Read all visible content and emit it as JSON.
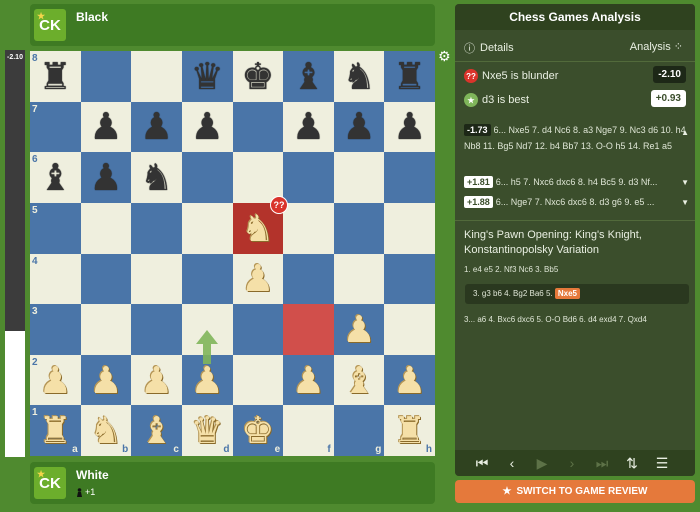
{
  "players": {
    "black": {
      "name": "Black",
      "logo": "CK"
    },
    "white": {
      "name": "White",
      "logo": "CK",
      "material": "+1"
    }
  },
  "eval_bar": {
    "label": "-2.10",
    "white_fraction": 0.31
  },
  "board": {
    "files": [
      "a",
      "b",
      "c",
      "d",
      "e",
      "f",
      "g",
      "h"
    ],
    "ranks": [
      "8",
      "7",
      "6",
      "5",
      "4",
      "3",
      "2",
      "1"
    ],
    "pieces": [
      {
        "sq": "a8",
        "p": "r",
        "c": "b"
      },
      {
        "sq": "d8",
        "p": "q",
        "c": "b"
      },
      {
        "sq": "e8",
        "p": "k",
        "c": "b"
      },
      {
        "sq": "f8",
        "p": "b",
        "c": "b"
      },
      {
        "sq": "g8",
        "p": "n",
        "c": "b"
      },
      {
        "sq": "h8",
        "p": "r",
        "c": "b"
      },
      {
        "sq": "b7",
        "p": "p",
        "c": "b"
      },
      {
        "sq": "c7",
        "p": "p",
        "c": "b"
      },
      {
        "sq": "d7",
        "p": "p",
        "c": "b"
      },
      {
        "sq": "f7",
        "p": "p",
        "c": "b"
      },
      {
        "sq": "g7",
        "p": "p",
        "c": "b"
      },
      {
        "sq": "h7",
        "p": "p",
        "c": "b"
      },
      {
        "sq": "a6",
        "p": "b",
        "c": "b"
      },
      {
        "sq": "b6",
        "p": "p",
        "c": "b"
      },
      {
        "sq": "c6",
        "p": "n",
        "c": "b"
      },
      {
        "sq": "e5",
        "p": "n",
        "c": "w"
      },
      {
        "sq": "e4",
        "p": "p",
        "c": "w"
      },
      {
        "sq": "g3",
        "p": "p",
        "c": "w"
      },
      {
        "sq": "a2",
        "p": "p",
        "c": "w"
      },
      {
        "sq": "b2",
        "p": "p",
        "c": "w"
      },
      {
        "sq": "c2",
        "p": "p",
        "c": "w"
      },
      {
        "sq": "d2",
        "p": "p",
        "c": "w"
      },
      {
        "sq": "f2",
        "p": "p",
        "c": "w"
      },
      {
        "sq": "g2",
        "p": "b",
        "c": "w"
      },
      {
        "sq": "h2",
        "p": "p",
        "c": "w"
      },
      {
        "sq": "a1",
        "p": "r",
        "c": "w"
      },
      {
        "sq": "b1",
        "p": "n",
        "c": "w"
      },
      {
        "sq": "c1",
        "p": "b",
        "c": "w"
      },
      {
        "sq": "d1",
        "p": "q",
        "c": "w"
      },
      {
        "sq": "e1",
        "p": "k",
        "c": "w"
      },
      {
        "sq": "h1",
        "p": "r",
        "c": "w"
      }
    ],
    "highlight_squares": {
      "e5": "#b3332b",
      "f3": "#d14f4b"
    },
    "blunder_badge": "??"
  },
  "panel": {
    "title": "Chess Games Analysis",
    "tab_details": "Details",
    "tab_analysis": "Analysis",
    "blunder": {
      "badge": "??",
      "text": "Nxe5 is blunder",
      "eval": "-2.10"
    },
    "best": {
      "badge": "★",
      "text": "d3 is best",
      "eval": "+0.93"
    },
    "lines": [
      {
        "eval": "-1.73",
        "text": "6... Nxe5 7. d4 Nc6 8. a3 Nge7 9. Nc3 d6 10. h4 Nb8 11. Bg5 Nd7 12. b4 Bb7 13. O-O h5 14. Re1 a5",
        "chip": "dark",
        "arrow": "▲"
      },
      {
        "eval": "+1.81",
        "text": "6... h5 7. Nxc6 dxc6 8. h4 Bc5 9. d3 Nf...",
        "chip": "light",
        "arrow": "▼"
      },
      {
        "eval": "+1.88",
        "text": "6... Nge7 7. Nxc6 dxc6 8. d3 g6 9. e5 ...",
        "chip": "light",
        "arrow": "▼"
      }
    ],
    "opening": "King's Pawn Opening: King's Knight, Konstantinopolsky Variation",
    "moves_before": "1. e4  e5  2. Nf3  Nc6  3. Bb5",
    "variation_prefix": "3. g3  b6  4. Bg2  Ba6  5.",
    "variation_move": "Nxe5",
    "moves_after": "3... a6  4. Bxc6  dxc6  5. O-O  Bd6  6. d4  exd4  7. Qxd4",
    "controls": [
      "⏮",
      "‹",
      "›",
      "⏭",
      "⇅",
      "☰"
    ]
  },
  "review_button": {
    "label": "SWITCH TO GAME REVIEW"
  },
  "colors": {
    "light": "#efefde",
    "dark": "#4a75a8",
    "accent": "#e5793b",
    "panel": "#3b4e2c"
  }
}
